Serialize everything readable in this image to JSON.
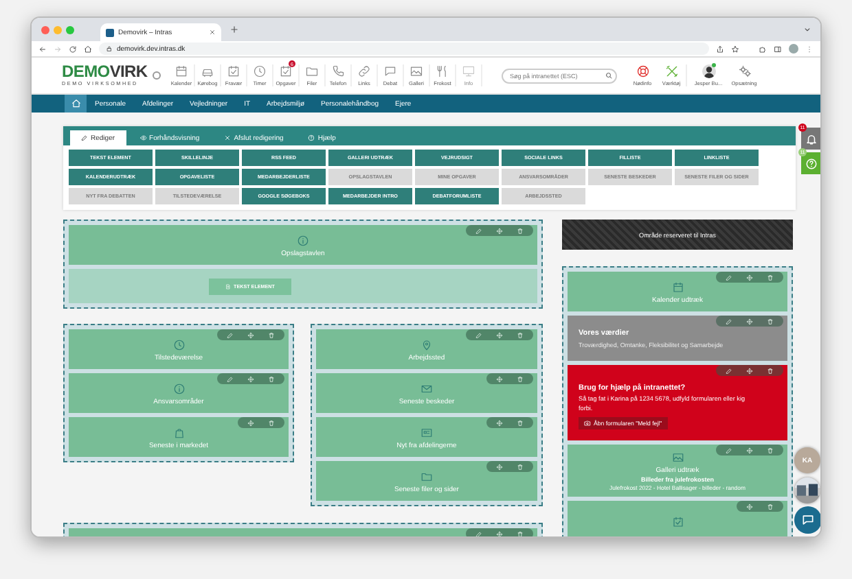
{
  "browser": {
    "tab_title": "Demovirk – Intras",
    "url": "demovirk.dev.intras.dk"
  },
  "header": {
    "logo": {
      "brand_a": "DEMO",
      "brand_b": "VIRK",
      "tagline": "DEMO VIRKSOMHED"
    },
    "shortcuts": [
      {
        "label": "Kalender",
        "disabled": false
      },
      {
        "label": "Kørebog",
        "disabled": false
      },
      {
        "label": "Fravær",
        "disabled": false
      },
      {
        "label": "Timer",
        "disabled": false
      },
      {
        "label": "Opgaver",
        "badge": "6",
        "disabled": false
      },
      {
        "label": "Filer",
        "disabled": false
      },
      {
        "label": "Telefon",
        "disabled": false
      },
      {
        "label": "Links",
        "disabled": false
      },
      {
        "label": "Debat",
        "disabled": false
      },
      {
        "label": "Galleri",
        "disabled": false
      },
      {
        "label": "Frokost",
        "disabled": false
      },
      {
        "label": "Info",
        "disabled": true
      }
    ],
    "search": {
      "placeholder": "Søg på intranettet (ESC)"
    },
    "tools": [
      {
        "label": "Nødinfo"
      },
      {
        "label": "Værktøj"
      }
    ],
    "user": {
      "name": "Jesper Bu...",
      "online": true
    },
    "settings": {
      "label": "Opsætning"
    }
  },
  "nav": {
    "home": {
      "selected": true
    },
    "items": [
      {
        "label": "Personale",
        "selected": false
      },
      {
        "label": "Afdelinger",
        "selected": false
      },
      {
        "label": "Vejledninger",
        "selected": false
      },
      {
        "label": "IT",
        "selected": false
      },
      {
        "label": "Arbejdsmiljø",
        "selected": false
      },
      {
        "label": "Personalehåndbog",
        "selected": false
      },
      {
        "label": "Ejere",
        "selected": false
      }
    ]
  },
  "editor": {
    "tabs": [
      {
        "label": "Rediger",
        "selected": true
      },
      {
        "label": "Forhåndsvisning",
        "selected": false
      },
      {
        "label": "Afslut redigering",
        "selected": false
      },
      {
        "label": "Hjælp",
        "selected": false
      }
    ],
    "elements": [
      {
        "label": "TEKST ELEMENT",
        "disabled": false
      },
      {
        "label": "SKILLELINJE",
        "disabled": false
      },
      {
        "label": "RSS FEED",
        "disabled": false
      },
      {
        "label": "GALLERI UDTRÆK",
        "disabled": false
      },
      {
        "label": "VEJRUDSIGT",
        "disabled": false
      },
      {
        "label": "SOCIALE LINKS",
        "disabled": false
      },
      {
        "label": "FILLISTE",
        "disabled": false
      },
      {
        "label": "LINKLISTE",
        "disabled": false
      },
      {
        "label": "KALENDERUDTRÆK",
        "disabled": false
      },
      {
        "label": "OPGAVELISTE",
        "disabled": false
      },
      {
        "label": "MEDARBEJDERLISTE",
        "disabled": false
      },
      {
        "label": "OPSLAGSTAVLEN",
        "disabled": true
      },
      {
        "label": "MINE OPGAVER",
        "disabled": true
      },
      {
        "label": "ANSVARSOMRÅDER",
        "disabled": true
      },
      {
        "label": "SENESTE BESKEDER",
        "disabled": true
      },
      {
        "label": "SENESTE FILER OG SIDER",
        "disabled": true
      },
      {
        "label": "NYT FRA DEBATTEN",
        "disabled": true
      },
      {
        "label": "TILSTEDEVÆRELSE",
        "disabled": true
      },
      {
        "label": "GOOGLE SØGEBOKS",
        "disabled": false
      },
      {
        "label": "MEDARBEJDER INTRO",
        "disabled": false
      },
      {
        "label": "DEBATFORUMLISTE",
        "disabled": false
      },
      {
        "label": "ARBEJDSSTED",
        "disabled": true
      }
    ]
  },
  "left": {
    "top_section": {
      "widgets": [
        {
          "kind": "tile",
          "title": "Opslagstavlen",
          "editable": true
        }
      ],
      "drop_button": "TEKST ELEMENT"
    },
    "columns": [
      [
        {
          "kind": "tile",
          "title": "Tilstedeværelse",
          "editable": true
        },
        {
          "kind": "tile",
          "title": "Ansvarsområder",
          "editable": true
        },
        {
          "kind": "tile",
          "title": "Seneste i markedet",
          "editable": false
        }
      ],
      [
        {
          "kind": "tile",
          "title": "Arbejdssted",
          "editable": true
        },
        {
          "kind": "tile",
          "title": "Seneste beskeder",
          "editable": false
        },
        {
          "kind": "tile",
          "title": "Nyt fra afdelingerne",
          "editable": false
        },
        {
          "kind": "tile",
          "title": "Seneste filer og sider",
          "editable": false
        }
      ]
    ],
    "bottom_section": {
      "widgets": [
        {
          "kind": "tile",
          "editable": true
        }
      ]
    }
  },
  "right": {
    "reserved": "Område reserveret til Intras",
    "widgets": [
      {
        "kind": "tile",
        "title": "Kalender udtræk",
        "editable": true
      },
      {
        "kind": "values",
        "title": "Vores værdier",
        "text": "Troværdighed, Omtanke, Fleksibilitet og Samarbejde",
        "editable": true
      },
      {
        "kind": "alert",
        "title": "Brug for hjælp på intranettet?",
        "text": "Så tag fat i Karina på 1234 5678, udfyld formularen eller kig forbi.",
        "button": "Åbn formularen \"Meld fejl\"",
        "editable": true
      },
      {
        "kind": "tile",
        "title": "Galleri udtræk",
        "subtitle": "Billeder fra julefrokosten",
        "text": "Julefrokost 2022 - Hotel Ballisager - billeder - random",
        "editable": true
      },
      {
        "kind": "tile",
        "editable": false
      }
    ]
  },
  "side": {
    "notifications": {
      "badge": "11"
    },
    "help": {
      "badge": "11"
    },
    "contacts": [
      {
        "initials": "KA"
      },
      {
        "kind": "picture"
      }
    ]
  }
}
